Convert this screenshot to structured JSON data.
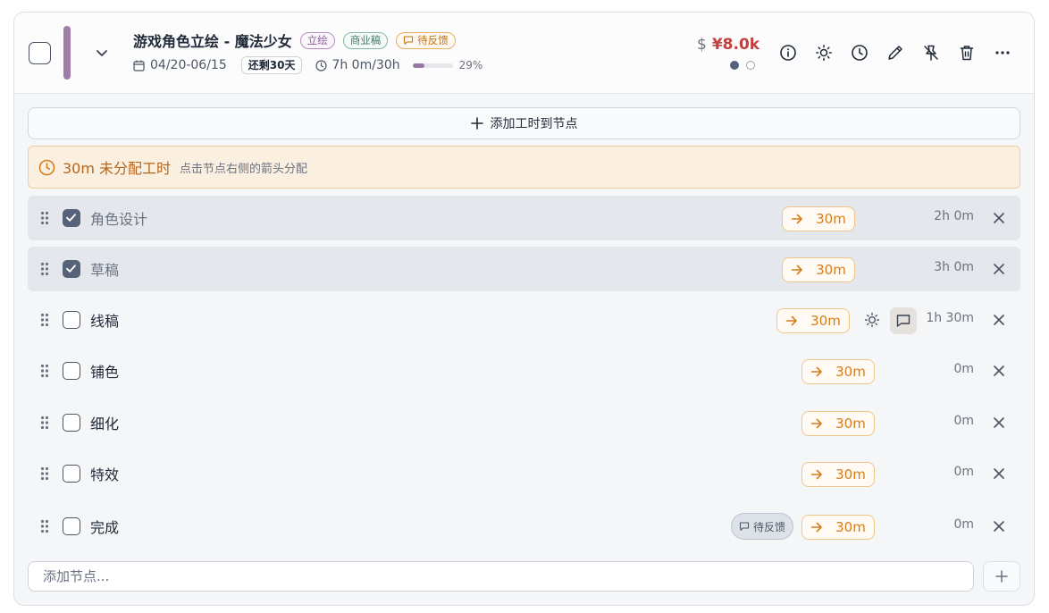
{
  "header": {
    "title": "游戏角色立绘 - 魔法少女",
    "tags": [
      "立绘",
      "商业稿",
      "待反馈"
    ],
    "date_range": "04/20-06/15",
    "remaining": "还剩30天",
    "hours": "7h 0m/30h",
    "progress_percent": 29,
    "progress_label": "29%",
    "currency_symbol": "$",
    "price": "¥8.0k",
    "accent_color": "#a07ca8"
  },
  "toolbar": {
    "add_time_label": "添加工时到节点"
  },
  "notice": {
    "main": "30m 未分配工时",
    "hint": "点击节点右侧的箭头分配"
  },
  "nodes": [
    {
      "label": "角色设计",
      "assign": "30m",
      "time": "2h 0m",
      "done": true
    },
    {
      "label": "草稿",
      "assign": "30m",
      "time": "3h 0m",
      "done": true
    },
    {
      "label": "线稿",
      "assign": "30m",
      "time": "1h 30m",
      "done": false
    },
    {
      "label": "铺色",
      "assign": "30m",
      "time": "0m",
      "done": false
    },
    {
      "label": "细化",
      "assign": "30m",
      "time": "0m",
      "done": false
    },
    {
      "label": "特效",
      "assign": "30m",
      "time": "0m",
      "done": false
    },
    {
      "label": "完成",
      "assign": "30m",
      "time": "0m",
      "done": false,
      "badge": "待反馈"
    }
  ],
  "add_node": {
    "placeholder": "添加节点..."
  }
}
